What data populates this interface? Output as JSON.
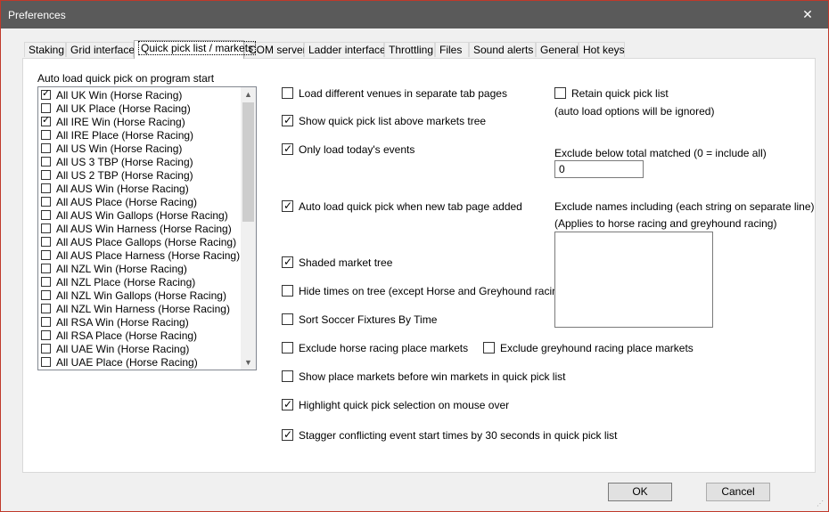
{
  "window": {
    "title": "Preferences",
    "close_glyph": "✕"
  },
  "tabs": [
    {
      "label": "Staking"
    },
    {
      "label": "Grid interface"
    },
    {
      "label": "Quick pick list / markets",
      "active": true
    },
    {
      "label": "COM server"
    },
    {
      "label": "Ladder interface"
    },
    {
      "label": "Throttling"
    },
    {
      "label": "Files"
    },
    {
      "label": "Sound alerts"
    },
    {
      "label": "General"
    },
    {
      "label": "Hot keys"
    }
  ],
  "autoload": {
    "label": "Auto load quick pick on program start",
    "items": [
      {
        "label": "All UK Win (Horse Racing)",
        "checked": true
      },
      {
        "label": "All UK Place (Horse Racing)",
        "checked": false
      },
      {
        "label": "All IRE Win (Horse Racing)",
        "checked": true
      },
      {
        "label": "All IRE Place (Horse Racing)",
        "checked": false
      },
      {
        "label": "All US Win (Horse Racing)",
        "checked": false
      },
      {
        "label": "All US 3 TBP (Horse Racing)",
        "checked": false
      },
      {
        "label": "All US 2 TBP (Horse Racing)",
        "checked": false
      },
      {
        "label": "All AUS Win (Horse Racing)",
        "checked": false
      },
      {
        "label": "All AUS Place (Horse Racing)",
        "checked": false
      },
      {
        "label": "All AUS Win Gallops (Horse Racing)",
        "checked": false
      },
      {
        "label": "All AUS Win Harness (Horse Racing)",
        "checked": false
      },
      {
        "label": "All AUS Place Gallops (Horse Racing)",
        "checked": false
      },
      {
        "label": "All AUS Place Harness (Horse Racing)",
        "checked": false
      },
      {
        "label": "All NZL Win (Horse Racing)",
        "checked": false
      },
      {
        "label": "All NZL Place (Horse Racing)",
        "checked": false
      },
      {
        "label": "All NZL Win Gallops (Horse Racing)",
        "checked": false
      },
      {
        "label": "All NZL Win Harness (Horse Racing)",
        "checked": false
      },
      {
        "label": "All RSA Win (Horse Racing)",
        "checked": false
      },
      {
        "label": "All RSA Place (Horse Racing)",
        "checked": false
      },
      {
        "label": "All UAE Win (Horse Racing)",
        "checked": false
      },
      {
        "label": "All UAE Place (Horse Racing)",
        "checked": false
      }
    ],
    "scroll_up_glyph": "▲",
    "scroll_down_glyph": "▼"
  },
  "options": {
    "load_different_venues": {
      "label": "Load different venues in separate tab pages",
      "checked": false
    },
    "show_quick_pick_above": {
      "label": "Show quick pick list above markets tree",
      "checked": true
    },
    "only_today": {
      "label": "Only load today's events",
      "checked": true
    },
    "auto_load_new_tab": {
      "label": "Auto load quick pick when new tab page added",
      "checked": true
    },
    "shaded_tree": {
      "label": "Shaded market tree",
      "checked": true
    },
    "hide_times": {
      "label": "Hide times on tree (except Horse and Greyhound racing)",
      "checked": false
    },
    "sort_soccer": {
      "label": "Sort Soccer Fixtures By Time",
      "checked": false
    },
    "exclude_horse_place": {
      "label": "Exclude horse racing place markets",
      "checked": false
    },
    "exclude_greyhound_place": {
      "label": "Exclude greyhound racing place markets",
      "checked": false
    },
    "show_place_before_win": {
      "label": "Show place markets before win markets in quick pick list",
      "checked": false
    },
    "highlight_mouse_over": {
      "label": "Highlight quick pick selection on mouse over",
      "checked": true
    },
    "stagger_times": {
      "label": "Stagger conflicting event start times by 30 seconds in quick pick list",
      "checked": true
    }
  },
  "right": {
    "retain": {
      "label": "Retain quick pick list",
      "checked": false
    },
    "retain_note": "(auto load options will be ignored)",
    "exclude_matched_label": "Exclude below total matched (0 = include all)",
    "exclude_matched_value": "0",
    "exclude_names_label": "Exclude names including (each string on separate line)",
    "exclude_names_note": "(Applies to horse racing and greyhound racing)",
    "exclude_names_value": ""
  },
  "buttons": {
    "ok": "OK",
    "cancel": "Cancel"
  }
}
